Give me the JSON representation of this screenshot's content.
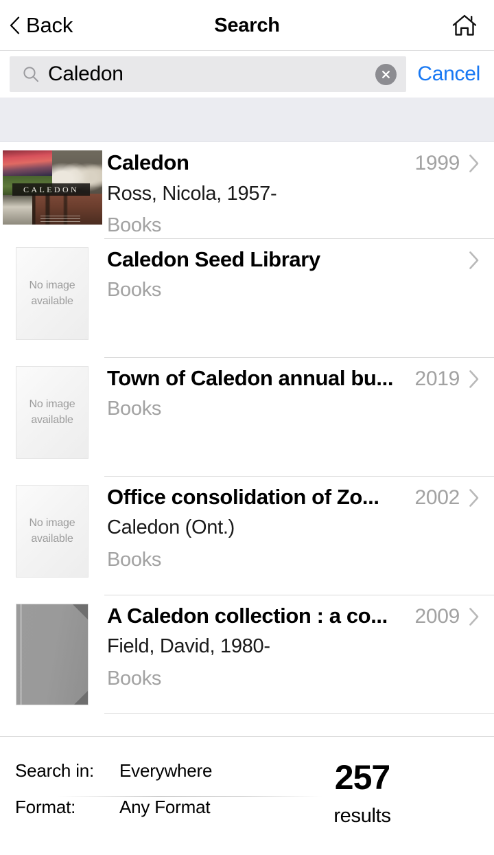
{
  "header": {
    "back_label": "Back",
    "title": "Search",
    "home_icon": "home-icon",
    "back_icon": "chevron-left-icon"
  },
  "search": {
    "value": "Caledon",
    "placeholder": "Search",
    "search_icon": "search-icon",
    "clear_icon": "clear-circle-icon",
    "cancel_label": "Cancel",
    "accent_color": "#1878f3"
  },
  "results": [
    {
      "title": "Caledon",
      "author": "Ross, Nicola, 1957-",
      "format": "Books",
      "year": "1999",
      "thumb_type": "cover-photo",
      "cover_text": "CALEDON",
      "chevron_icon": "chevron-right-icon"
    },
    {
      "title": "Caledon Seed Library",
      "author": "",
      "format": "Books",
      "year": "",
      "thumb_type": "no-image",
      "placeholder_line1": "No image",
      "placeholder_line2": "available",
      "chevron_icon": "chevron-right-icon"
    },
    {
      "title": "Town of Caledon annual bu...",
      "author": "",
      "format": "Books",
      "year": "2019",
      "thumb_type": "no-image",
      "placeholder_line1": "No image",
      "placeholder_line2": "available",
      "chevron_icon": "chevron-right-icon"
    },
    {
      "title": "Office consolidation of Zo...",
      "author": "Caledon (Ont.)",
      "format": "Books",
      "year": "2002",
      "thumb_type": "no-image",
      "placeholder_line1": "No image",
      "placeholder_line2": "available",
      "chevron_icon": "chevron-right-icon"
    },
    {
      "title": "A Caledon collection : a co...",
      "author": "Field, David, 1980-",
      "format": "Books",
      "year": "2009",
      "thumb_type": "gray-book",
      "chevron_icon": "chevron-right-icon"
    }
  ],
  "footer": {
    "search_in_label": "Search in:",
    "search_in_value": "Everywhere",
    "format_label": "Format:",
    "format_value": "Any Format",
    "count_number": "257",
    "count_label": "results"
  }
}
